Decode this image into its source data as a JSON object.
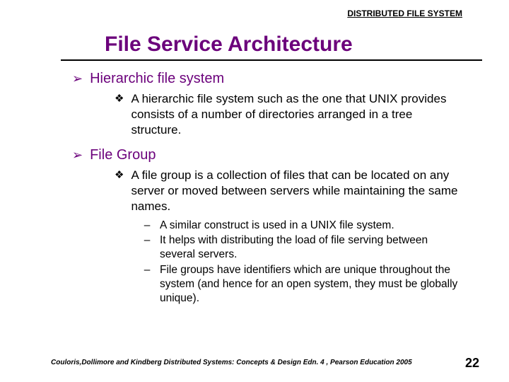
{
  "header_label": "DISTRIBUTED FILE SYSTEM",
  "title": "File Service Architecture",
  "sections": [
    {
      "heading": "Hierarchic file system",
      "subs": [
        {
          "text": "A hierarchic file system such as the one that UNIX provides consists of a number of directories arranged in a tree structure.",
          "dashes": []
        }
      ]
    },
    {
      "heading": "File Group",
      "subs": [
        {
          "text": "A file group is a collection of files that can be located on any server or moved between servers while maintaining the same names.",
          "dashes": [
            "A similar construct is used in a UNIX file system.",
            "It helps with distributing the load of file serving between several servers.",
            "File groups have identifiers which are unique throughout the system (and hence for an open system, they must be globally unique)."
          ]
        }
      ]
    }
  ],
  "footer": "Couloris,Dollimore and Kindberg  Distributed Systems: Concepts & Design  Edn. 4 , Pearson Education 2005",
  "page_number": "22",
  "bullets": {
    "arrow": "➢",
    "diamond": "❖",
    "dash": "–"
  }
}
